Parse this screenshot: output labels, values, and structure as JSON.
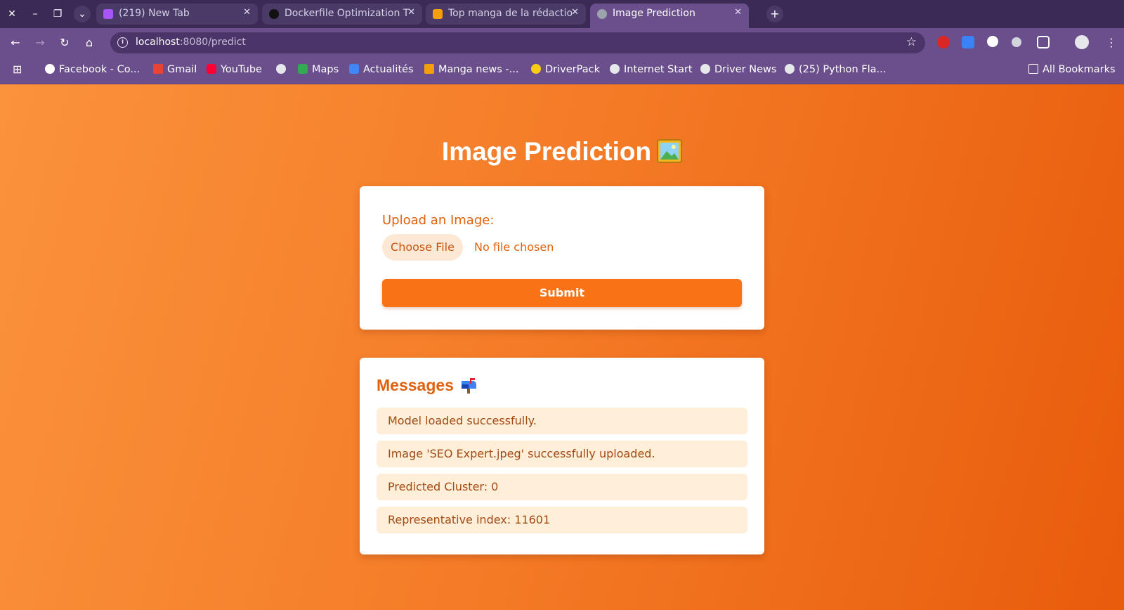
{
  "tabs": [
    {
      "title": "(219) New Tab",
      "icon": "twitch-like-icon",
      "color": "#a855f7"
    },
    {
      "title": "Dockerfile Optimization T",
      "icon": "chatgpt-icon",
      "color": "#111111"
    },
    {
      "title": "Top manga de la rédactio",
      "icon": "manga-news-icon",
      "color": "#f59e0b"
    },
    {
      "title": "Image Prediction",
      "icon": "globe-icon",
      "color": "#9ca3af"
    }
  ],
  "address_bar": {
    "host": "localhost",
    "path": ":8080/predict"
  },
  "bookmarks": [
    {
      "label": "Facebook - Co...",
      "icon": "google-icon"
    },
    {
      "label": "Gmail",
      "icon": "gmail-icon"
    },
    {
      "label": "YouTube",
      "icon": "youtube-icon"
    },
    {
      "label": "",
      "icon": "globe-icon"
    },
    {
      "label": "Maps",
      "icon": "maps-icon"
    },
    {
      "label": "Actualités",
      "icon": "news-icon"
    },
    {
      "label": "Manga news -...",
      "icon": "manga-news-icon"
    },
    {
      "label": "DriverPack",
      "icon": "driverpack-icon"
    },
    {
      "label": "Internet Start",
      "icon": "globe-icon"
    },
    {
      "label": "Driver News",
      "icon": "globe-icon"
    },
    {
      "label": "(25) Python Fla...",
      "icon": "globe-icon"
    }
  ],
  "all_bookmarks": "All Bookmarks",
  "page": {
    "title": "Image Prediction",
    "upload": {
      "label": "Upload an Image:",
      "choose_button": "Choose File",
      "file_status": "No file chosen",
      "submit": "Submit"
    },
    "messages": {
      "title": "Messages",
      "items": [
        "Model loaded successfully.",
        "Image 'SEO Expert.jpeg' successfully uploaded.",
        "Predicted Cluster: 0",
        "Representative index: 11601"
      ]
    }
  },
  "colors": {
    "accent": "#f97316",
    "accent_text": "#e0620e",
    "message_bg": "#ffeed8",
    "chrome": "#6a4f8c"
  }
}
